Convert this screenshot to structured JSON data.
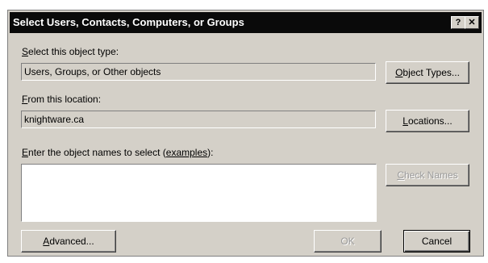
{
  "dialog": {
    "title": "Select Users, Contacts, Computers, or Groups",
    "help_glyph": "?",
    "close_glyph": "✕"
  },
  "object_type": {
    "label_mnemonic": "S",
    "label_rest": "elect this object type:",
    "value": "Users, Groups, or Other objects",
    "button_mnemonic": "O",
    "button_rest": "bject Types..."
  },
  "location": {
    "label_mnemonic": "F",
    "label_rest": "rom this location:",
    "value": "knightware.ca",
    "button_mnemonic": "L",
    "button_rest": "ocations..."
  },
  "names": {
    "label_mnemonic": "E",
    "label_rest": "nter the object names to select (",
    "link": "examples",
    "label_end": "):",
    "value": "",
    "check_mnemonic": "C",
    "check_rest": "heck Names"
  },
  "footer": {
    "advanced_mnemonic": "A",
    "advanced_rest": "dvanced...",
    "ok": "OK",
    "cancel": "Cancel"
  }
}
